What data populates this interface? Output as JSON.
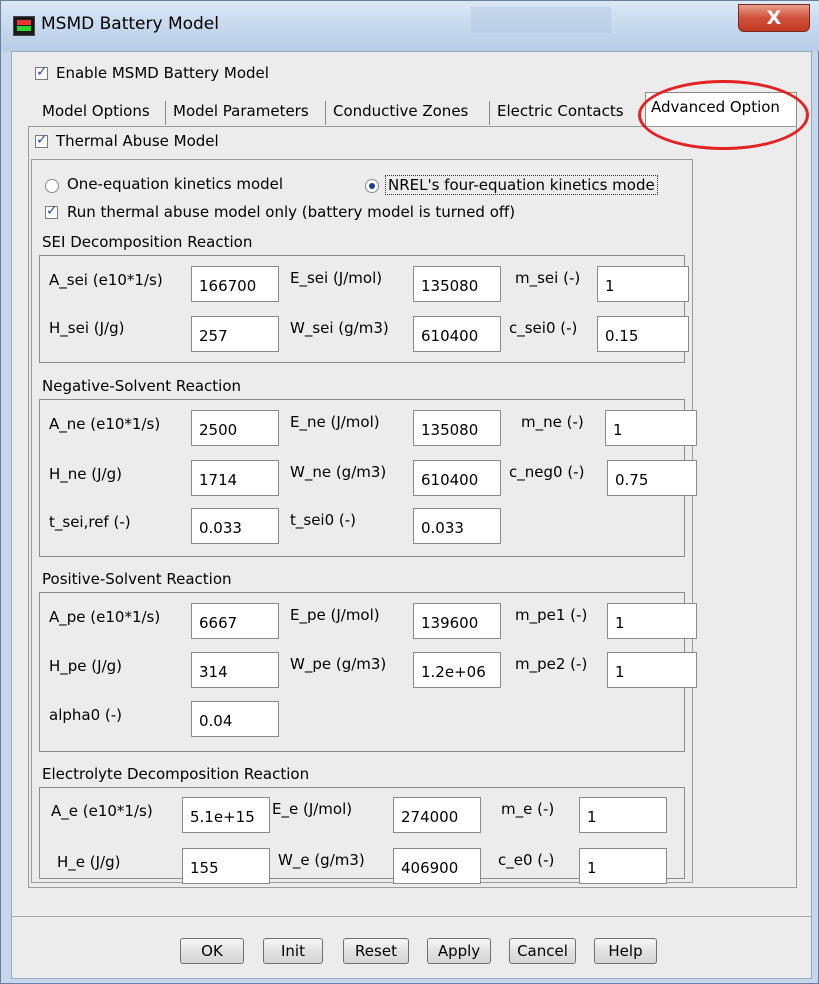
{
  "window": {
    "title": "MSMD Battery Model",
    "close_glyph": "X"
  },
  "enable_model": {
    "label": "Enable MSMD Battery Model",
    "checked": true
  },
  "tabs": [
    {
      "label": "Model Options"
    },
    {
      "label": "Model Parameters"
    },
    {
      "label": "Conductive Zones"
    },
    {
      "label": "Electric Contacts"
    },
    {
      "label": "Advanced Option",
      "active": true
    }
  ],
  "thermal_abuse": {
    "label": "Thermal Abuse Model",
    "checked": true
  },
  "kinetics": {
    "one_eq_label": "One-equation kinetics model",
    "nrel_label": "NREL's four-equation kinetics mode",
    "selected": "NREL's four-equation kinetics mode"
  },
  "run_only": {
    "label": "Run thermal abuse model only (battery model is turned off)",
    "checked": true
  },
  "sei": {
    "title": "SEI Decomposition Reaction",
    "A_label": "A_sei (e10*1/s)",
    "A_value": "166700",
    "E_label": "E_sei (J/mol)",
    "E_value": "135080",
    "m_label": "m_sei (-)",
    "m_value": "1",
    "H_label": "H_sei (J/g)",
    "H_value": "257",
    "W_label": "W_sei (g/m3)",
    "W_value": "610400",
    "c_label": "c_sei0 (-)",
    "c_value": "0.15"
  },
  "ne": {
    "title": "Negative-Solvent Reaction",
    "A_label": "A_ne (e10*1/s)",
    "A_value": "2500",
    "E_label": "E_ne (J/mol)",
    "E_value": "135080",
    "m_label": "m_ne (-)",
    "m_value": "1",
    "H_label": "H_ne (J/g)",
    "H_value": "1714",
    "W_label": "W_ne (g/m3)",
    "W_value": "610400",
    "c_label": "c_neg0 (-)",
    "c_value": "0.75",
    "tref_label": "t_sei,ref (-)",
    "tref_value": "0.033",
    "t0_label": "t_sei0 (-)",
    "t0_value": "0.033"
  },
  "pe": {
    "title": "Positive-Solvent Reaction",
    "A_label": "A_pe (e10*1/s)",
    "A_value": "6667",
    "E_label": "E_pe (J/mol)",
    "E_value": "139600",
    "m1_label": "m_pe1 (-)",
    "m1_value": "1",
    "H_label": "H_pe (J/g)",
    "H_value": "314",
    "W_label": "W_pe (g/m3)",
    "W_value": "1.2e+06",
    "m2_label": "m_pe2 (-)",
    "m2_value": "1",
    "alpha_label": "alpha0 (-)",
    "alpha_value": "0.04"
  },
  "ed": {
    "title": "Electrolyte Decomposition Reaction",
    "A_label": "A_e (e10*1/s)",
    "A_value": "5.1e+15",
    "E_label": "E_e (J/mol)",
    "E_value": "274000",
    "m_label": "m_e (-)",
    "m_value": "1",
    "H_label": "H_e (J/g)",
    "H_value": "155",
    "W_label": "W_e (g/m3)",
    "W_value": "406900",
    "c_label": "c_e0 (-)",
    "c_value": "1"
  },
  "buttons": {
    "ok": "OK",
    "init": "Init",
    "reset": "Reset",
    "apply": "Apply",
    "cancel": "Cancel",
    "help": "Help"
  },
  "colors": {
    "annotation": "#e32222",
    "window_frame": "#c5d7ec",
    "close_button": "#c8452c"
  }
}
